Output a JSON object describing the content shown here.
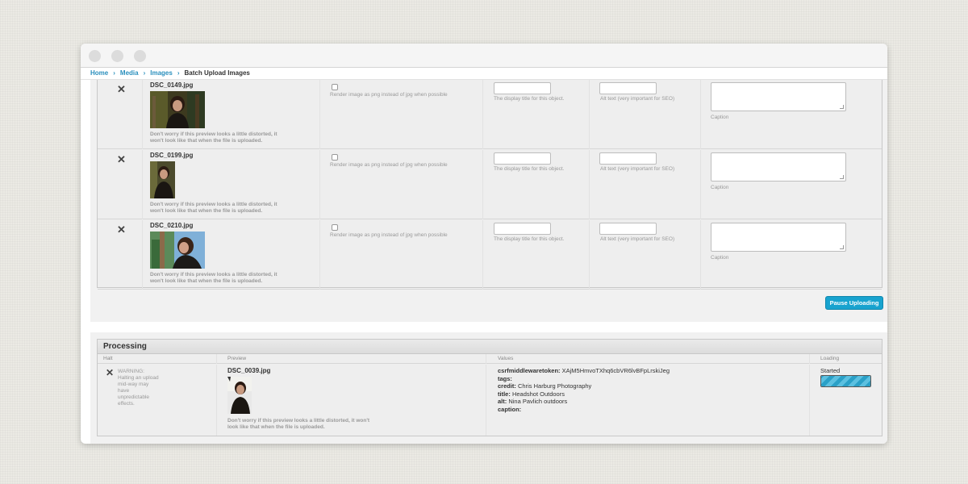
{
  "breadcrumb": {
    "items": [
      "Home",
      "Media",
      "Images"
    ],
    "current": "Batch Upload Images"
  },
  "upload_rows": [
    {
      "filename": "DSC_0149.jpg",
      "png_label": "Render image as png instead of jpg when possible",
      "title_hint": "The display title for this object.",
      "alt_hint": "Alt text (very important for SEO)",
      "caption_hint": "Caption",
      "distort_note": "Don't worry if this preview looks a little distorted, it won't look like that when the file is uploaded."
    },
    {
      "filename": "DSC_0199.jpg",
      "png_label": "Render image as png instead of jpg when possible",
      "title_hint": "The display title for this object.",
      "alt_hint": "Alt text (very important for SEO)",
      "caption_hint": "Caption",
      "distort_note": "Don't worry if this preview looks a little distorted, it won't look like that when the file is uploaded."
    },
    {
      "filename": "DSC_0210.jpg",
      "png_label": "Render image as png instead of jpg when possible",
      "title_hint": "The display title for this object.",
      "alt_hint": "Alt text (very important for SEO)",
      "caption_hint": "Caption",
      "distort_note": "Don't worry if this preview looks a little distorted, it won't look like that when the file is uploaded."
    }
  ],
  "pause_label": "Pause Uploading",
  "processing": {
    "title": "Processing",
    "columns": [
      "Halt",
      "Preview",
      "Values",
      "Loading"
    ],
    "warning": "WARNING: Halting an upload mid-way may have unpredictable effects.",
    "filename": "DSC_0039.jpg",
    "distort_note": "Don't worry if this preview looks a little distorted, it won't look like that when the file is uploaded.",
    "values": {
      "csrf_label": "csrfmiddlewaretoken:",
      "csrf_value": "XAjM5HmvoTXhq6cbVR6lvBFpLrskiJeg",
      "tags_label": "tags:",
      "tags_value": "",
      "credit_label": "credit:",
      "credit_value": "Chris Harburg Photography",
      "title_label": "title:",
      "title_value": "Headshot Outdoors",
      "alt_label": "alt:",
      "alt_value": "Nina Pavlich outdoors",
      "caption_label": "caption:",
      "caption_value": ""
    },
    "status": "Started",
    "progress": 1.0
  },
  "colors": {
    "link": "#2a8fbd",
    "button": "#18a3cf",
    "progress": "#2aa0c7"
  }
}
